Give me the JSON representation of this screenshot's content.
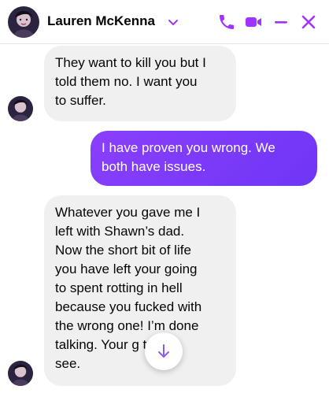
{
  "header": {
    "contact_name": "Lauren McKenna",
    "icons": [
      "avatar",
      "chevron-down-icon",
      "phone-icon",
      "video-icon",
      "minimize-icon",
      "close-icon"
    ],
    "accent_color": "#a033ff"
  },
  "messages": [
    {
      "direction": "incoming",
      "text": "They want to kill you but I\ntold them  no. I want you\nto suffer."
    },
    {
      "direction": "outgoing",
      "text": "I have proven you wrong. We\nboth have issues."
    },
    {
      "direction": "incoming",
      "text": "Whatever you gave me I\nleft with Shawn’s dad.\nNow the short bit of life\nyou have left your going\nto spent rotting in hell\nbecause you fucked with\nthe wrong one! I’m done\ntalking. Your g         to\nsee."
    }
  ],
  "colors": {
    "incoming_bubble": "#f0f0f0",
    "outgoing_bubble": "#7b3cf7",
    "scroll_arrow": "#8a5cf5"
  }
}
